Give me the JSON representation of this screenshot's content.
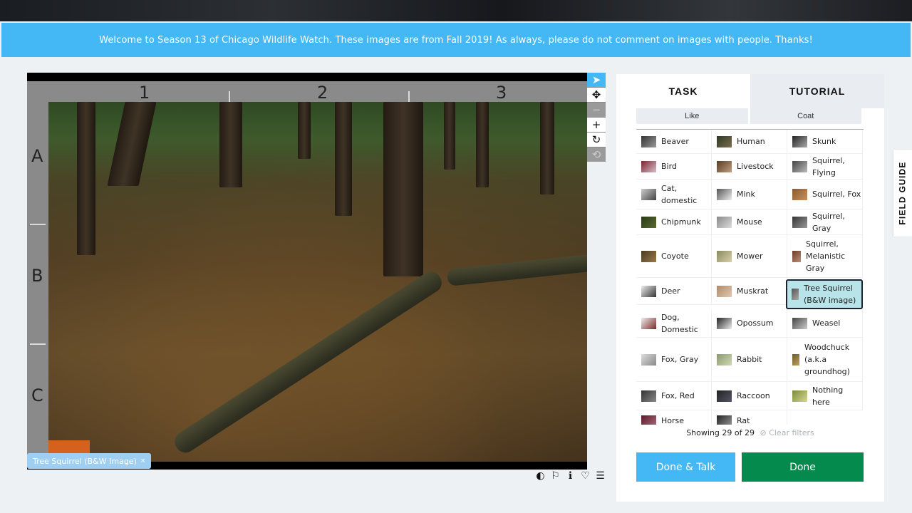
{
  "banner": {
    "text": "Welcome to Season 13 of Chicago Wildlife Watch. These images are from Fall 2019! As always, please do not comment on images with people. Thanks!"
  },
  "viewer": {
    "columns": [
      "1",
      "2",
      "3"
    ],
    "rows": [
      "A",
      "B",
      "C"
    ],
    "selected_chip": "Tree Squirrel (B&W Image)",
    "chip_close": "×"
  },
  "tools": [
    {
      "name": "pointer",
      "glyph": "➤"
    },
    {
      "name": "move",
      "glyph": "✥"
    },
    {
      "name": "zoom-out",
      "glyph": "−"
    },
    {
      "name": "zoom-in",
      "glyph": "+"
    },
    {
      "name": "rotate",
      "glyph": "↻"
    },
    {
      "name": "reset",
      "glyph": "⟲"
    }
  ],
  "image_actions": [
    {
      "name": "invert-icon",
      "glyph": "◐"
    },
    {
      "name": "flag-icon",
      "glyph": "⚐"
    },
    {
      "name": "info-icon",
      "glyph": "ℹ"
    },
    {
      "name": "heart-icon",
      "glyph": "♡"
    },
    {
      "name": "collection-icon",
      "glyph": "☰"
    }
  ],
  "task": {
    "tabs": [
      "TASK",
      "TUTORIAL"
    ],
    "filters": [
      "Like",
      "Coat"
    ],
    "choices": [
      "Beaver",
      "Human",
      "Skunk",
      "Bird",
      "Livestock",
      "Squirrel, Flying",
      "Cat, domestic",
      "Mink",
      "Squirrel, Fox",
      "Chipmunk",
      "Mouse",
      "Squirrel, Gray",
      "Coyote",
      "Mower",
      "Squirrel, Melanistic Gray",
      "Deer",
      "Muskrat",
      "Tree Squirrel (B&W image)",
      "Dog, Domestic",
      "Opossum",
      "Weasel",
      "Fox, Gray",
      "Rabbit",
      "Woodchuck (a.k.a groundhog)",
      "Fox, Red",
      "Raccoon",
      "Nothing here",
      "Horse",
      "Rat"
    ],
    "selected_choice": "Tree Squirrel (B&W image)",
    "showing": "Showing 29 of 29",
    "clear_filters": "⊘ Clear filters",
    "done_talk": "Done & Talk",
    "done": "Done"
  },
  "field_guide": "FIELD GUIDE",
  "colors": {
    "accent": "#43b8f5",
    "done": "#058a4e",
    "selected": "#b8e4e9"
  }
}
